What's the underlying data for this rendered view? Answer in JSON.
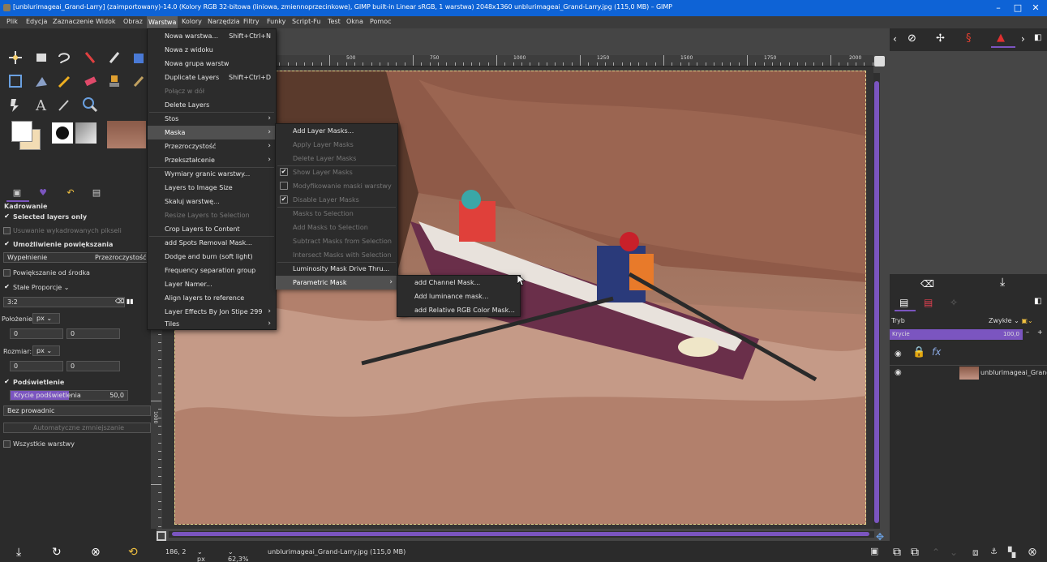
{
  "window": {
    "title": "[unblurimageai_Grand-Larry] (zaimportowany)-14.0 (Kolory RGB 32-bitowa (liniowa, zmiennoprzecinkowe), GIMP built-in Linear sRGB, 1 warstwa) 2048x1360 unblurimageai_Grand-Larry.jpg (115,0 MB) – GIMP",
    "minimize": "–",
    "maximize": "□",
    "close": "✕"
  },
  "menubar": [
    "Plik",
    "Edycja",
    "Zaznaczenie",
    "Widok",
    "Obraz",
    "Warstwa",
    "Kolory",
    "Narzędzia",
    "Filtry",
    "Funky",
    "Script-Fu",
    "Test",
    "Okna",
    "Pomoc"
  ],
  "layer_menu": {
    "items": [
      {
        "label": "Nowa warstwa...",
        "shortcut": "Shift+Ctrl+N"
      },
      {
        "label": "Nowa z widoku"
      },
      {
        "label": "Nowa grupa warstw"
      },
      {
        "label": "Duplicate Layers",
        "shortcut": "Shift+Ctrl+D"
      },
      {
        "label": "Połącz w dół",
        "disabled": true
      },
      {
        "label": "Delete Layers"
      },
      {
        "label": "Stos",
        "submenu": true
      },
      {
        "label": "Maska",
        "submenu": true,
        "highlighted": true
      },
      {
        "label": "Przezroczystość",
        "submenu": true
      },
      {
        "label": "Przekształcenie",
        "submenu": true
      },
      {
        "label": "Wymiary granic warstwy..."
      },
      {
        "label": "Layers to Image Size"
      },
      {
        "label": "Skaluj warstwę..."
      },
      {
        "label": "Resize Layers to Selection",
        "disabled": true
      },
      {
        "label": "Crop Layers to Content"
      },
      {
        "label": "add Spots Removal Mask..."
      },
      {
        "label": "Dodge and burn (soft light)"
      },
      {
        "label": "Frequency separation group"
      },
      {
        "label": "Layer Namer..."
      },
      {
        "label": "Align layers to reference"
      },
      {
        "label": "Layer Effects By Jon Stipe 299",
        "submenu": true
      },
      {
        "label": "Tiles",
        "submenu": true
      }
    ]
  },
  "mask_menu": {
    "items": [
      {
        "label": "Add Layer Masks..."
      },
      {
        "label": "Apply Layer Masks",
        "disabled": true
      },
      {
        "label": "Delete Layer Masks",
        "disabled": true
      },
      {
        "label": "Show Layer Masks",
        "disabled": true,
        "checked": true
      },
      {
        "label": "Modyfikowanie maski warstwy",
        "disabled": true,
        "checked": false
      },
      {
        "label": "Disable Layer Masks",
        "disabled": true,
        "checked": true
      },
      {
        "label": "Masks to Selection",
        "disabled": true
      },
      {
        "label": "Add Masks to Selection",
        "disabled": true
      },
      {
        "label": "Subtract Masks from Selection",
        "disabled": true
      },
      {
        "label": "Intersect Masks with Selection",
        "disabled": true
      },
      {
        "label": "Luminosity Mask Drive Thru..."
      },
      {
        "label": "Parametric Mask",
        "submenu": true,
        "highlighted": true
      }
    ]
  },
  "parametric_menu": {
    "items": [
      {
        "label": "add Channel Mask..."
      },
      {
        "label": "Add luminance mask..."
      },
      {
        "label": "add Relative RGB Color Mask..."
      }
    ]
  },
  "tool_options": {
    "title": "Kadrowanie",
    "selected_layers_only": "Selected layers only",
    "delete_cropped": "Usuwanie wykadrowanych pikseli",
    "allow_growing": "Umożliwienie powiększania",
    "fill_label": "Wypełnienie",
    "fill_value": "Przezroczystość",
    "expand_center": "Powiększanie od środka",
    "fixed_label": "Stałe",
    "fixed_value": "Proporcje",
    "ratio": "3:2",
    "position_label": "Położenie:",
    "unit": "px",
    "pos_x": "0",
    "pos_y": "0",
    "size_label": "Rozmiar:",
    "size_w": "0",
    "size_h": "0",
    "highlight": "Podświetlenie",
    "highlight_opacity_label": "Krycie podświetlenia",
    "highlight_opacity_value": "50,0",
    "guides": "Bez prowadnic",
    "auto_shrink": "Automatyczne zmniejszanie",
    "all_layers": "Wszystkie warstwy"
  },
  "ruler_labels": [
    "500",
    "750",
    "1000",
    "1250",
    "1500",
    "1750",
    "2000"
  ],
  "ruler_v_labels": [
    "1000"
  ],
  "status": {
    "coords": "186, 2",
    "unit": "px",
    "zoom": "62,3%",
    "file": "unblurimageai_Grand-Larry.jpg (115,0 MB)"
  },
  "layers_panel": {
    "mode_label": "Tryb",
    "mode_value": "Zwykłe",
    "opacity_label": "Krycie",
    "opacity_value": "100,0",
    "layer_name": "unblurimageai_Grand-"
  },
  "colors": {
    "accent": "#7b55c0",
    "titlebar": "#0e63d6"
  }
}
